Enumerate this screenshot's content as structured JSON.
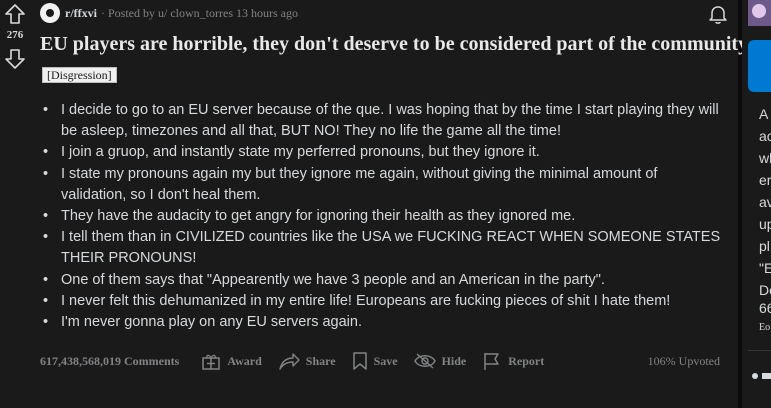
{
  "post": {
    "score": "276",
    "subreddit": "r/ffxvi",
    "posted_by": "· Posted by u/ clown_torres 13 hours ago",
    "title": "EU players are horrible, they don't deserve to be considered part of the community.",
    "flair": "[Disgression]",
    "body_items": [
      "I decide to go to an EU server because of the que. I was hoping that by the time I start playing they will be asleep, timezones and all that, BUT NO! They no life the game all the time!",
      "I join a gruop, and instantly state my perferred pronouns, but they ignore it.",
      "I state my pronouns again my but they ignore me again, without giving the minimal amount of validation, so I don't heal them.",
      "They have the audacity to get angry for ignoring their health as they ignored me.",
      "I tell them than in CIVILIZED countries like the USA we FUCKING REACT WHEN SOMEONE STATES THEIR PRONOUNS!",
      "One of them says that \"Appearently we have 3 people and an American in the party\".",
      "I never felt this dehumanized in my entire life! Europeans are fucking pieces of shit I hate them!",
      "I'm never gonna play on any EU servers again."
    ],
    "actions": {
      "comments": "617,438,568,019 Comments",
      "award": "Award",
      "share": "Share",
      "save": "Save",
      "hide": "Hide",
      "report": "Report"
    },
    "upvoted": "106% Upvoted"
  },
  "sidebar": {
    "text_lines": [
      "A",
      "ac",
      "wl",
      "er",
      "av",
      "up",
      "pl",
      "\"E",
      "Do"
    ],
    "stat": "66",
    "stat_label": "Eo"
  },
  "icons": {
    "upvote": "arrow-up-icon",
    "downvote": "arrow-down-icon",
    "notifications": "bell-icon",
    "award": "gift-icon",
    "share": "share-arrow-icon",
    "save": "bookmark-icon",
    "hide": "eye-slash-icon",
    "report": "flag-icon"
  },
  "colors": {
    "background": "#1a1a1b",
    "text": "#d7dadc",
    "muted": "#818384",
    "flair_bg": "#f0f0f0"
  }
}
